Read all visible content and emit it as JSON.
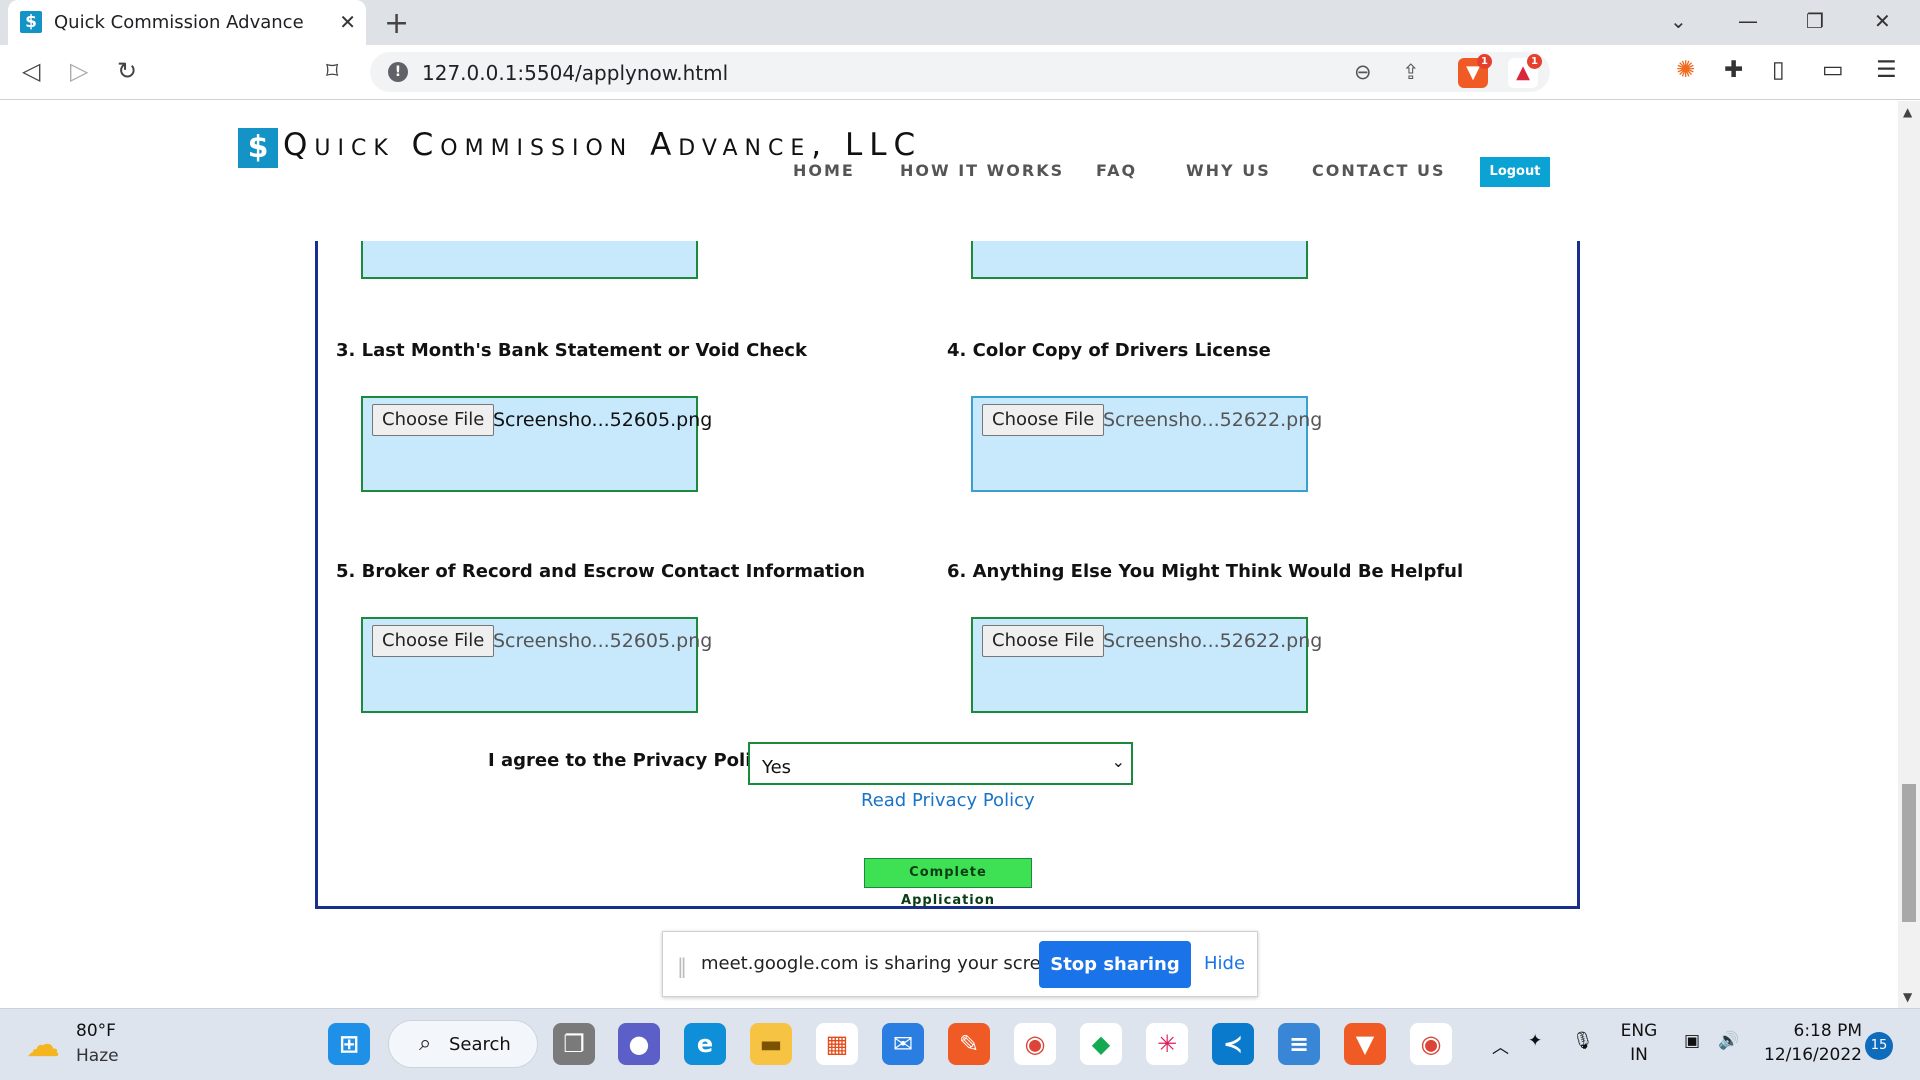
{
  "browser": {
    "tab_title": "Quick Commission Advance",
    "tab_favicon": "$",
    "tab_close": "✕",
    "new_tab": "+",
    "url": "127.0.0.1:5504/applynow.html",
    "shield_badge": "1",
    "rewards_badge": "1"
  },
  "site": {
    "logo_icon": "$",
    "logo_text": "Quick Commission Advance, LLC",
    "nav": {
      "home": "HOME",
      "how": "HOW IT WORKS",
      "faq": "FAQ",
      "why": "WHY US",
      "contact": "CONTACT US",
      "logout": "Logout"
    }
  },
  "form": {
    "q3": "3. Last Month's Bank Statement or Void Check",
    "q4": "4. Color Copy of Drivers License",
    "q5": "5. Broker of Record and Escrow Contact Information",
    "q6": "6. Anything Else You Might Think Would Be Helpful",
    "choose_label": "Choose File",
    "file_a": "Screensho...52605.png",
    "file_b": "Screensho...52622.png",
    "privacy_label": "I agree to the Privacy Policy:",
    "privacy_value": "Yes",
    "privacy_link": "Read Privacy Policy",
    "submit": "Complete Application"
  },
  "share_bar": {
    "text": "meet.google.com is sharing your screen.",
    "stop": "Stop sharing",
    "hide": "Hide"
  },
  "taskbar": {
    "temp": "80°F",
    "weather": "Haze",
    "search": "Search",
    "lang_top": "ENG",
    "lang_bottom": "IN",
    "time": "6:18 PM",
    "date": "12/16/2022",
    "notifications": "15"
  },
  "colors": {
    "brand": "#1493c7",
    "upload_bg": "#c8e8fb",
    "upload_border": "#1c8a3c",
    "form_border": "#1a2e8c",
    "submit_bg": "#3ee154",
    "share_blue": "#1a73e8"
  }
}
